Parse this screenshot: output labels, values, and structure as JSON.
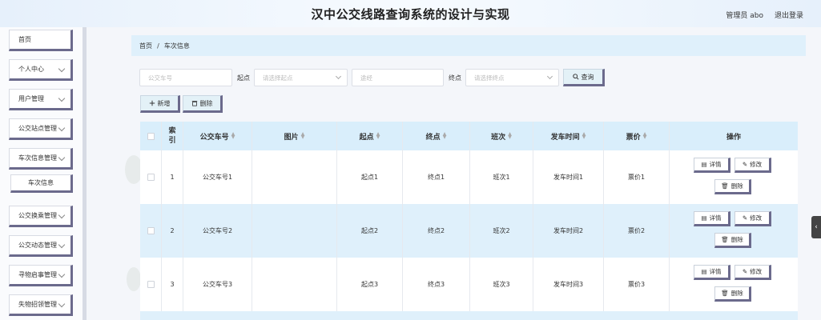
{
  "header": {
    "title": "汉中公交线路查询系统的设计与实现",
    "user_label": "管理员 abo",
    "logout_label": "退出登录"
  },
  "sidebar": {
    "items": [
      {
        "label": "首页"
      },
      {
        "label": "个人中心"
      },
      {
        "label": "用户管理"
      },
      {
        "label": "公交站点管理"
      },
      {
        "label": "车次信息管理"
      },
      {
        "label": "公交换乘管理"
      },
      {
        "label": "公交动态管理"
      },
      {
        "label": "寻物启事管理"
      },
      {
        "label": "失物招领管理"
      }
    ],
    "submenu": {
      "label": "车次信息"
    }
  },
  "breadcrumb": {
    "home": "首页",
    "sep": "/",
    "current": "车次信息"
  },
  "search": {
    "bus_no_placeholder": "公交车号",
    "start_label": "起点",
    "start_placeholder": "请选择起点",
    "via_placeholder": "途经",
    "end_label": "终点",
    "end_placeholder": "请选择终点",
    "query_label": "查询"
  },
  "actions": {
    "add_label": "新增",
    "delete_label": "删除"
  },
  "table": {
    "headers": {
      "index": "索引",
      "bus_no": "公交车号",
      "image": "图片",
      "start": "起点",
      "end": "终点",
      "shift": "班次",
      "depart_time": "发车时间",
      "fare": "票价",
      "ops": "操作"
    },
    "row_buttons": {
      "detail": "详情",
      "edit": "修改",
      "delete": "删除"
    },
    "rows": [
      {
        "index": "1",
        "bus_no": "公交车号1",
        "start": "起点1",
        "end": "终点1",
        "shift": "班次1",
        "depart_time": "发车时间1",
        "fare": "票价1"
      },
      {
        "index": "2",
        "bus_no": "公交车号2",
        "start": "起点2",
        "end": "终点2",
        "shift": "班次2",
        "depart_time": "发车时间2",
        "fare": "票价2"
      },
      {
        "index": "3",
        "bus_no": "公交车号3",
        "start": "起点3",
        "end": "终点3",
        "shift": "班次3",
        "depart_time": "发车时间3",
        "fare": "票价3"
      }
    ]
  },
  "colors": {
    "accent": "#6b6a8c",
    "row_alt": "#dff0fb",
    "header_bg": "#d9eefb"
  },
  "icons": [
    "plus-icon",
    "trash-icon",
    "search-icon",
    "detail-icon",
    "edit-icon",
    "chevron-down-icon",
    "chevron-left-icon"
  ]
}
